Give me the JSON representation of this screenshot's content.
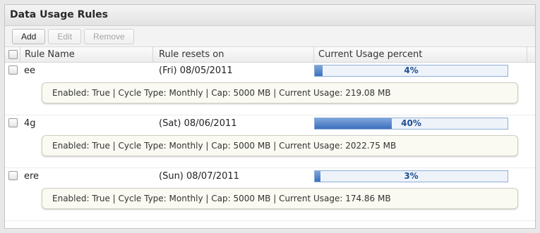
{
  "panel": {
    "title": "Data Usage Rules"
  },
  "toolbar": {
    "add_label": "Add",
    "edit_label": "Edit",
    "remove_label": "Remove"
  },
  "columns": {
    "rule_name": "Rule Name",
    "resets_on": "Rule resets on",
    "usage_percent": "Current Usage percent"
  },
  "rules": [
    {
      "name": "ee",
      "resets_on": "(Fri) 08/05/2011",
      "usage_label": "4%",
      "usage_fraction": 0.04,
      "detail": "Enabled: True | Cycle Type: Monthly | Cap: 5000 MB | Current Usage: 219.08 MB"
    },
    {
      "name": "4g",
      "resets_on": "(Sat) 08/06/2011",
      "usage_label": "40%",
      "usage_fraction": 0.4,
      "detail": "Enabled: True | Cycle Type: Monthly | Cap: 5000 MB | Current Usage: 2022.75 MB"
    },
    {
      "name": "ere",
      "resets_on": "(Sun) 08/07/2011",
      "usage_label": "3%",
      "usage_fraction": 0.03,
      "detail": "Enabled: True | Cycle Type: Monthly | Cap: 5000 MB | Current Usage: 174.86 MB"
    }
  ],
  "colors": {
    "bar_fill": "#3c6fbd",
    "bar_border": "#8eaed6",
    "percent_text": "#1f4f92"
  }
}
